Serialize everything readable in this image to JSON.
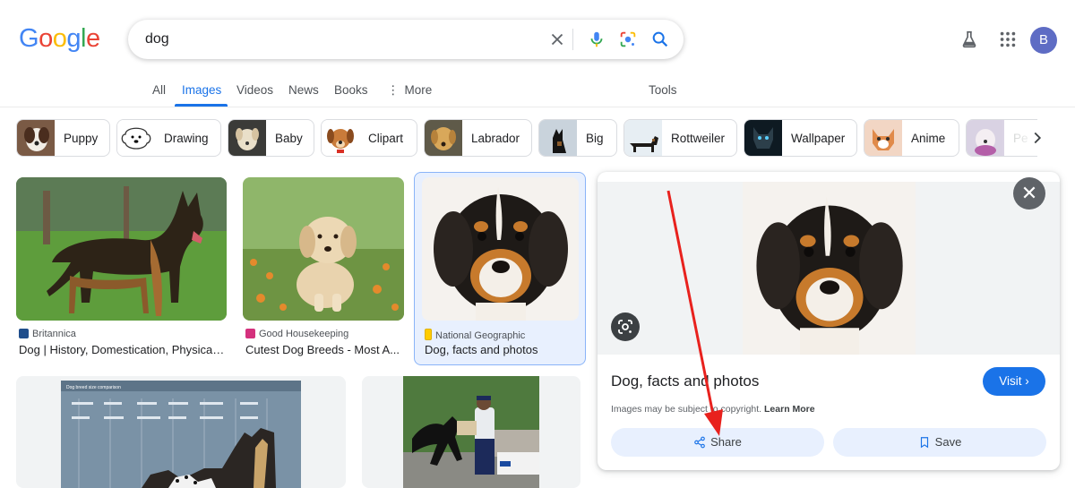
{
  "logo": {
    "g1": "G",
    "o1": "o",
    "o2": "o",
    "g2": "g",
    "l": "l",
    "e": "e"
  },
  "search": {
    "query": "dog"
  },
  "header_icons": [
    "clear-icon",
    "mic-icon",
    "lens-icon",
    "search-icon",
    "labs-flask-icon",
    "apps-grid-icon"
  ],
  "account": {
    "initial": "B"
  },
  "tabs": [
    {
      "label": "All"
    },
    {
      "label": "Images",
      "active": true
    },
    {
      "label": "Videos"
    },
    {
      "label": "News"
    },
    {
      "label": "Books"
    },
    {
      "label": "More"
    }
  ],
  "tools_label": "Tools",
  "chips": [
    {
      "label": "Puppy"
    },
    {
      "label": "Drawing"
    },
    {
      "label": "Baby"
    },
    {
      "label": "Clipart"
    },
    {
      "label": "Labrador"
    },
    {
      "label": "Big"
    },
    {
      "label": "Rottweiler"
    },
    {
      "label": "Wallpaper"
    },
    {
      "label": "Anime"
    },
    {
      "label": "Pe"
    }
  ],
  "results": [
    {
      "source": "Britannica",
      "title": "Dog | History, Domestication, Physical ..."
    },
    {
      "source": "Good Housekeeping",
      "title": "Cutest Dog Breeds - Most A..."
    },
    {
      "source": "National Geographic",
      "title": "Dog, facts and photos"
    }
  ],
  "chart_caption": "Dog breed size comparison",
  "panel": {
    "title": "Dog, facts and photos",
    "visit_label": "Visit",
    "copyright_text": "Images may be subject to copyright.",
    "learn_more": "Learn More",
    "share_label": "Share",
    "save_label": "Save"
  },
  "colors": {
    "accent": "#1a73e8",
    "annotation_arrow": "#e8211d",
    "selected_bg": "#e8f0fe"
  }
}
